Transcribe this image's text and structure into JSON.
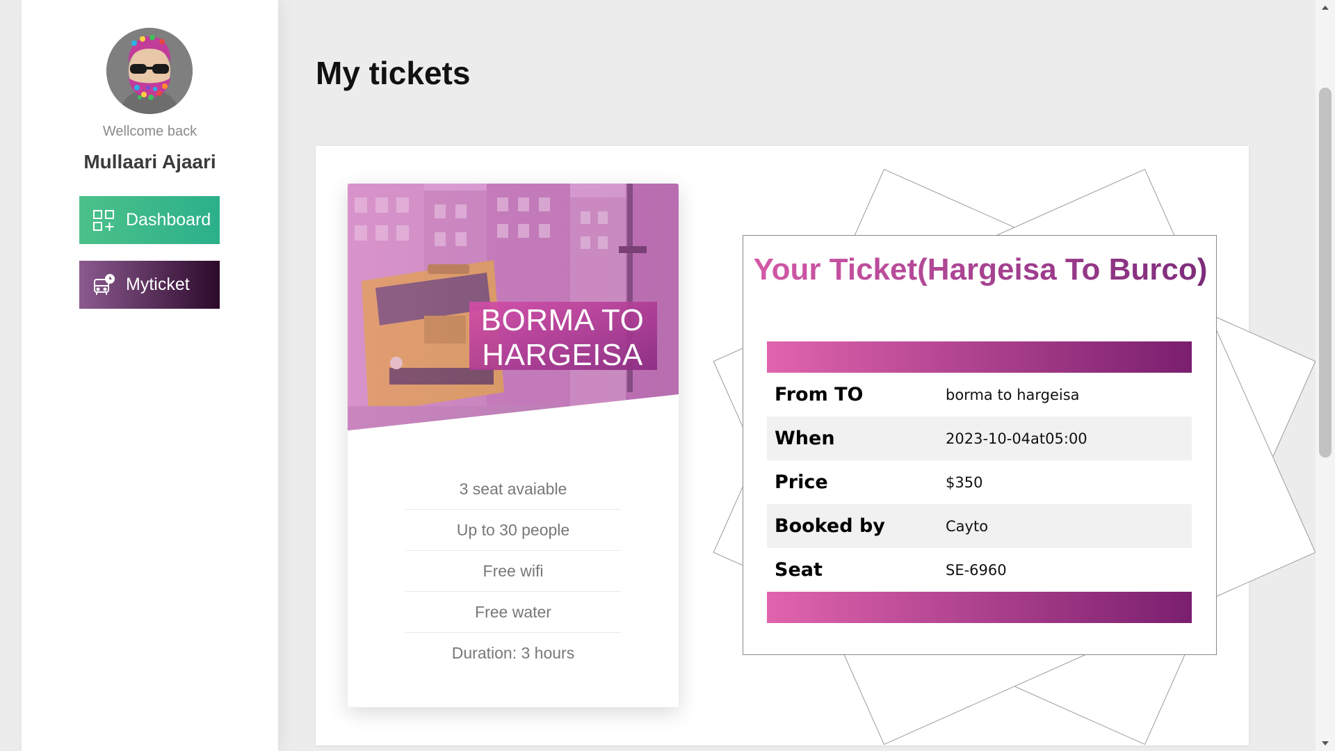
{
  "sidebar": {
    "welcome": "Wellcome back",
    "username": "Mullaari Ajaari",
    "nav": [
      {
        "label": "Dashboard",
        "icon": "dashboard-grid-icon",
        "color": "#3cb98a"
      },
      {
        "label": "Myticket",
        "icon": "bus-clock-icon",
        "color": "#5a2a5a"
      }
    ]
  },
  "main": {
    "title": "My tickets"
  },
  "bus_card": {
    "route": "BORMA TO HARGEISA",
    "features": [
      "3 seat avaiable",
      "Up to 30 people",
      "Free wifi",
      "Free water",
      "Duration: 3 hours"
    ]
  },
  "ticket": {
    "title": "Your Ticket(Hargeisa To Burco)",
    "rows": [
      {
        "label": "From TO",
        "value": "borma to hargeisa"
      },
      {
        "label": "When",
        "value": "2023-10-04at05:00"
      },
      {
        "label": "Price",
        "value": "$350"
      },
      {
        "label": "Booked by",
        "value": "Cayto"
      },
      {
        "label": "Seat",
        "value": "SE-6960"
      }
    ],
    "accent_colors": [
      "#e064ad",
      "#7a1f6e"
    ]
  }
}
